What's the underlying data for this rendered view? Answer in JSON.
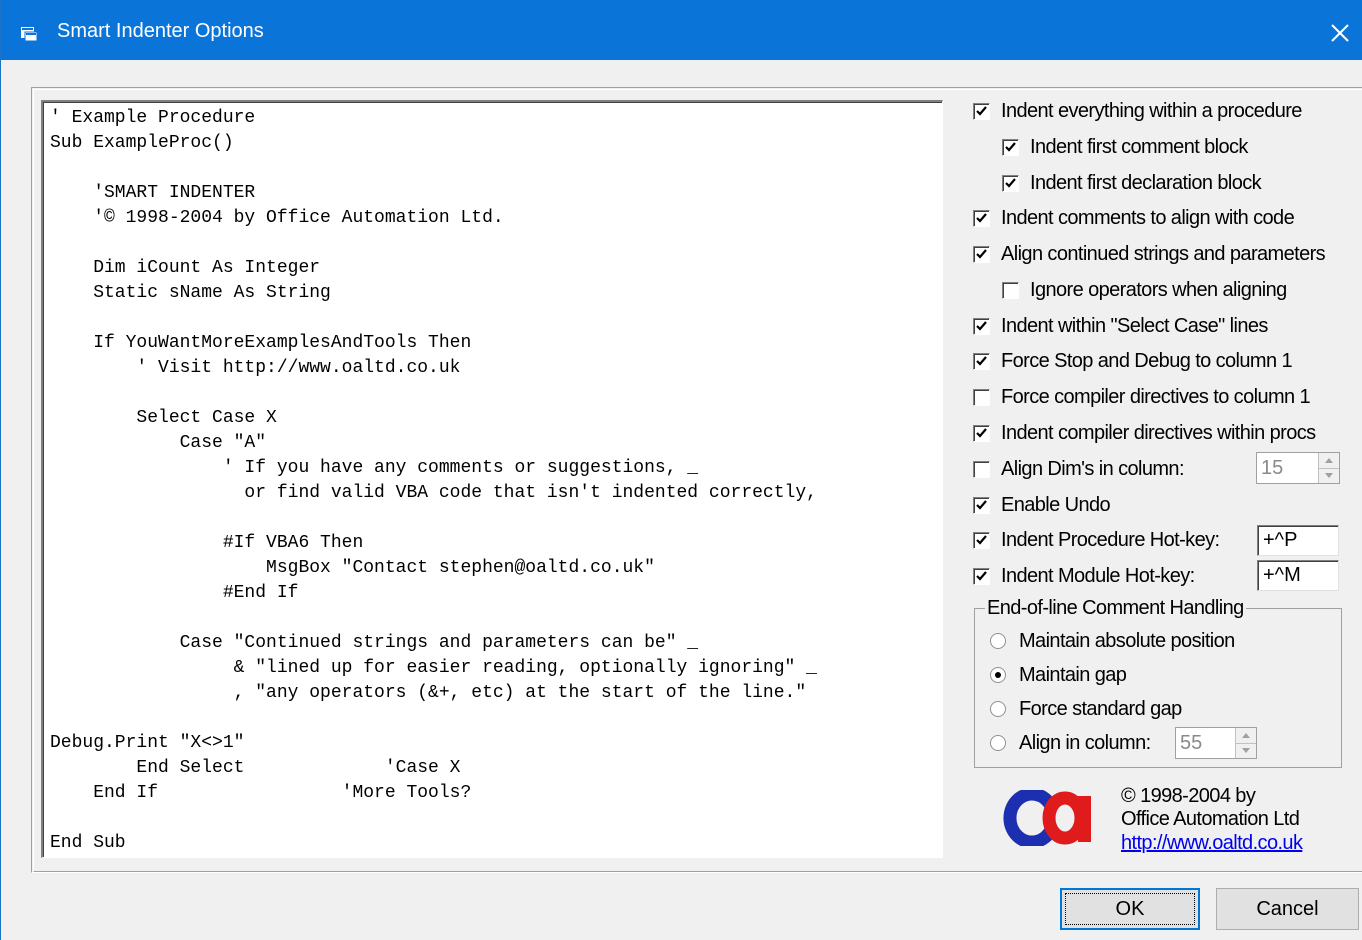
{
  "window": {
    "title": "Smart Indenter Options"
  },
  "code": {
    "lines": [
      "' Example Procedure",
      "Sub ExampleProc()",
      "",
      "    'SMART INDENTER",
      "    '© 1998-2004 by Office Automation Ltd.",
      "",
      "    Dim iCount As Integer",
      "    Static sName As String",
      "",
      "    If YouWantMoreExamplesAndTools Then",
      "        ' Visit http://www.oaltd.co.uk",
      "",
      "        Select Case X",
      "            Case \"A\"",
      "                ' If you have any comments or suggestions, _",
      "                  or find valid VBA code that isn't indented correctly,",
      "",
      "                #If VBA6 Then",
      "                    MsgBox \"Contact stephen@oaltd.co.uk\"",
      "                #End If",
      "",
      "            Case \"Continued strings and parameters can be\" _",
      "                 & \"lined up for easier reading, optionally ignoring\" _",
      "                 , \"any operators (&+, etc) at the start of the line.\"",
      "",
      "Debug.Print \"X<>1\"",
      "        End Select             'Case X",
      "    End If                 'More Tools?",
      "",
      "End Sub"
    ]
  },
  "options": {
    "indent_proc": {
      "label": "Indent everything within a procedure",
      "checked": true
    },
    "indent_first_comment": {
      "label": "Indent first comment block",
      "checked": true
    },
    "indent_first_decl": {
      "label": "Indent first declaration block",
      "checked": true
    },
    "indent_comments": {
      "label": "Indent comments to align with code",
      "checked": true
    },
    "align_continued": {
      "label": "Align continued strings and parameters",
      "checked": true
    },
    "ignore_operators": {
      "label": "Ignore operators when aligning",
      "checked": false
    },
    "indent_select_case": {
      "label": "Indent within \"Select Case\" lines",
      "checked": true
    },
    "force_stop_debug": {
      "label": "Force Stop and Debug to column 1",
      "checked": true
    },
    "force_compiler": {
      "label": "Force compiler directives to column 1",
      "checked": false
    },
    "indent_compiler": {
      "label": "Indent compiler directives within procs",
      "checked": true
    },
    "align_dims": {
      "label": "Align Dim's in column:",
      "checked": false,
      "value": "15"
    },
    "enable_undo": {
      "label": "Enable Undo",
      "checked": true
    },
    "proc_hotkey": {
      "label": "Indent Procedure Hot-key:",
      "checked": true,
      "value": "+^P"
    },
    "module_hotkey": {
      "label": "Indent Module Hot-key:",
      "checked": true,
      "value": "+^M"
    }
  },
  "eol_group": {
    "title": "End-of-line Comment Handling",
    "absolute": {
      "label": "Maintain absolute position",
      "selected": false
    },
    "gap": {
      "label": "Maintain gap",
      "selected": true
    },
    "standard": {
      "label": "Force standard gap",
      "selected": false
    },
    "column": {
      "label": "Align in column:",
      "selected": false,
      "value": "55"
    }
  },
  "about": {
    "copyright": "© 1998-2004 by",
    "company": "Office Automation Ltd",
    "url": "http://www.oaltd.co.uk"
  },
  "buttons": {
    "ok": "OK",
    "cancel": "Cancel"
  },
  "colors": {
    "titlebar": "#0a74d8",
    "logo_blue": "#1c2fb0",
    "logo_red": "#e01b1b",
    "link": "#0000ee"
  }
}
